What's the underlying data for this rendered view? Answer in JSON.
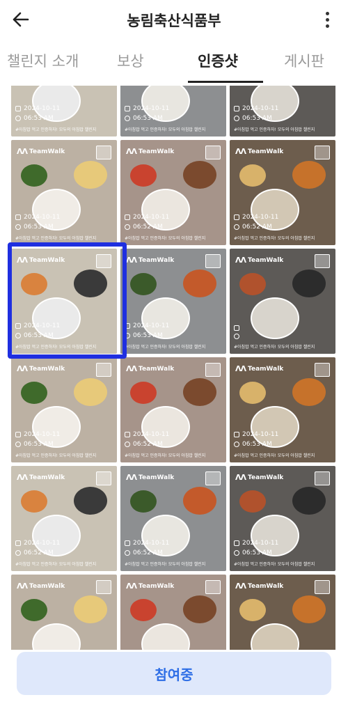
{
  "header": {
    "title": "농림축산식품부"
  },
  "tabs": [
    "챌린지 소개",
    "보상",
    "인증샷",
    "게시판"
  ],
  "tile": {
    "brand": "TeamWalk",
    "caption": "#아침밥 먹고 인증하자! 모두의 아침밥 챌린지"
  },
  "rows": [
    [
      {
        "date": "2024-10-11",
        "time": "06:53 AM"
      },
      {
        "date": "2024-10-11",
        "time": "06:53 AM"
      },
      {
        "date": "2024-10-11",
        "time": "06:53 AM"
      }
    ],
    [
      {
        "date": "2024-10-11",
        "time": "06:53 AM"
      },
      {
        "date": "2024-10-11",
        "time": "06:52 AM"
      },
      {
        "date": "2024-10-11",
        "time": "06:52 AM"
      }
    ],
    [
      {
        "date": "2024-10-11",
        "time": "06:53 AM"
      },
      {
        "date": "2024-10-11",
        "time": "06:53 AM"
      },
      {
        "date": "",
        "time": ""
      }
    ],
    [
      {
        "date": "2024-10-11",
        "time": "06:53 AM"
      },
      {
        "date": "2024-10-11",
        "time": "06:52 AM"
      },
      {
        "date": "2024-10-11",
        "time": "06:53 AM"
      }
    ],
    [
      {
        "date": "2024-10-11",
        "time": "06:52 AM"
      },
      {
        "date": "2024-10-11",
        "time": "06:52 AM"
      },
      {
        "date": "2024-10-11",
        "time": "06:53 AM"
      }
    ],
    [
      {
        "date": "",
        "time": ""
      },
      {
        "date": "",
        "time": ""
      },
      {
        "date": "",
        "time": ""
      }
    ]
  ],
  "bottom": {
    "join_label": "참여중"
  },
  "colors": {
    "accent": "#2e6ee6",
    "button_bg": "#dfe8fb",
    "highlight": "#1f2fe0"
  }
}
